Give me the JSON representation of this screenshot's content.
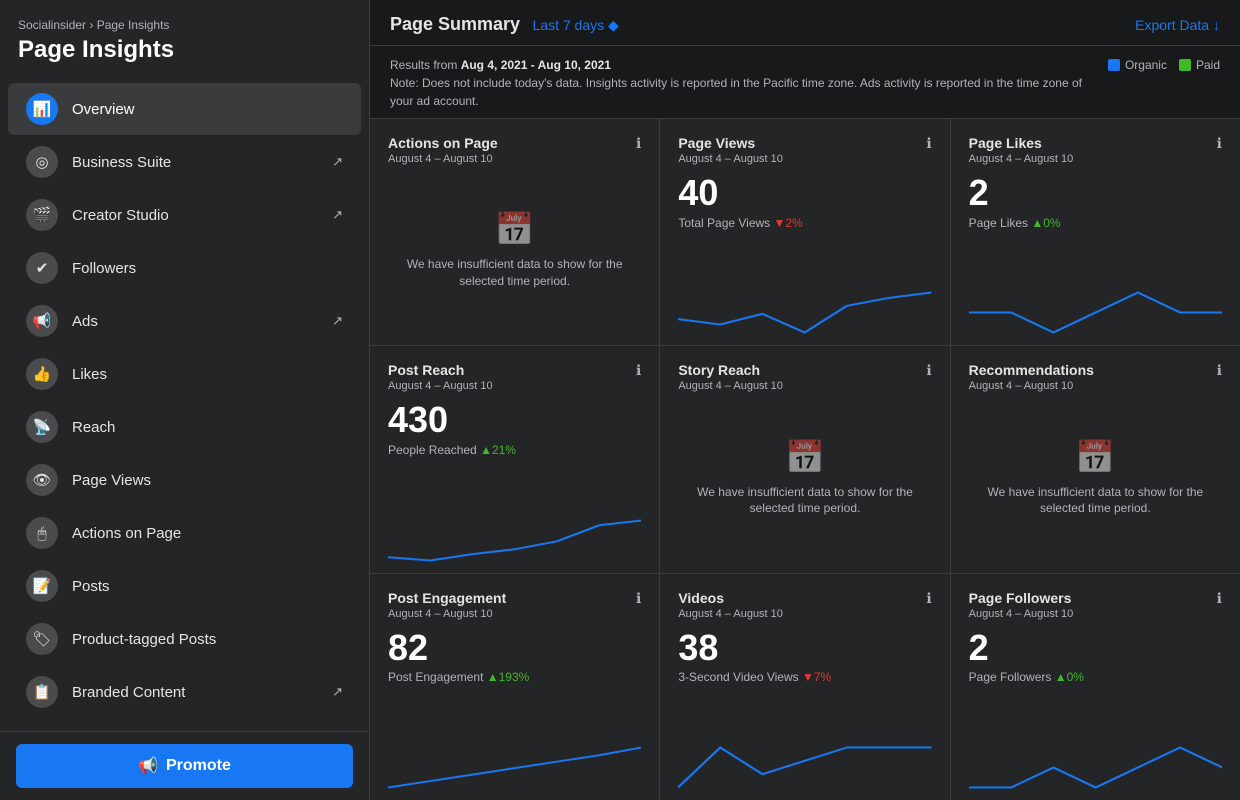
{
  "sidebar": {
    "breadcrumb": "Socialinsider › Page Insights",
    "title": "Page Insights",
    "nav_items": [
      {
        "id": "overview",
        "label": "Overview",
        "icon": "📊",
        "active": true,
        "external": false
      },
      {
        "id": "business-suite",
        "label": "Business Suite",
        "icon": "◎",
        "active": false,
        "external": true
      },
      {
        "id": "creator-studio",
        "label": "Creator Studio",
        "icon": "🎬",
        "active": false,
        "external": true
      },
      {
        "id": "followers",
        "label": "Followers",
        "icon": "✔",
        "active": false,
        "external": false
      },
      {
        "id": "ads",
        "label": "Ads",
        "icon": "📢",
        "active": false,
        "external": true
      },
      {
        "id": "likes",
        "label": "Likes",
        "icon": "👍",
        "active": false,
        "external": false
      },
      {
        "id": "reach",
        "label": "Reach",
        "icon": "📡",
        "active": false,
        "external": false
      },
      {
        "id": "page-views",
        "label": "Page Views",
        "icon": "👁",
        "active": false,
        "external": false
      },
      {
        "id": "actions-on-page",
        "label": "Actions on Page",
        "icon": "🖱",
        "active": false,
        "external": false
      },
      {
        "id": "posts",
        "label": "Posts",
        "icon": "📝",
        "active": false,
        "external": false
      },
      {
        "id": "product-tagged",
        "label": "Product-tagged Posts",
        "icon": "🏷",
        "active": false,
        "external": false
      },
      {
        "id": "branded-content",
        "label": "Branded Content",
        "icon": "📋",
        "active": false,
        "external": true
      }
    ],
    "promote_label": "Promote"
  },
  "header": {
    "title": "Page Summary",
    "time_filter": "Last 7 days ◆",
    "export_label": "Export Data ↓"
  },
  "results": {
    "date_range": "Aug 4, 2021 - Aug 10, 2021",
    "note": "Note: Does not include today's data. Insights activity is reported in the Pacific time zone. Ads activity is reported in the time zone of your ad account.",
    "legend": [
      {
        "label": "Organic",
        "color": "#1877f2"
      },
      {
        "label": "Paid",
        "color": "#42b72a"
      }
    ]
  },
  "metrics": [
    {
      "title": "Actions on Page",
      "date": "August 4 – August 10",
      "value": null,
      "sub_label": null,
      "change": null,
      "change_type": null,
      "insufficient": true,
      "insufficient_text": "We have insufficient data to show for the selected time period."
    },
    {
      "title": "Page Views",
      "date": "August 4 – August 10",
      "value": "40",
      "sub_label": "Total Page Views",
      "change": "▼2%",
      "change_type": "down",
      "insufficient": false
    },
    {
      "title": "Page Likes",
      "date": "August 4 – August 10",
      "value": "2",
      "sub_label": "Page Likes",
      "change": "▲0%",
      "change_type": "up",
      "insufficient": false
    },
    {
      "title": "Post Reach",
      "date": "August 4 – August 10",
      "value": "430",
      "sub_label": "People Reached",
      "change": "▲21%",
      "change_type": "up",
      "insufficient": false
    },
    {
      "title": "Story Reach",
      "date": "August 4 – August 10",
      "value": null,
      "sub_label": null,
      "change": null,
      "change_type": null,
      "insufficient": true,
      "insufficient_text": "We have insufficient data to show for the selected time period."
    },
    {
      "title": "Recommendations",
      "date": "August 4 – August 10",
      "value": null,
      "sub_label": null,
      "change": null,
      "change_type": null,
      "insufficient": true,
      "insufficient_text": "We have insufficient data to show for the selected time period."
    },
    {
      "title": "Post Engagement",
      "date": "August 4 – August 10",
      "value": "82",
      "sub_label": "Post Engagement",
      "change": "▲193%",
      "change_type": "up",
      "insufficient": false
    },
    {
      "title": "Videos",
      "date": "August 4 – August 10",
      "value": "38",
      "sub_label": "3-Second Video Views",
      "change": "▼7%",
      "change_type": "down",
      "insufficient": false
    },
    {
      "title": "Page Followers",
      "date": "August 4 – August 10",
      "value": "2",
      "sub_label": "Page Followers",
      "change": "▲0%",
      "change_type": "up",
      "insufficient": false
    }
  ],
  "charts": {
    "page_views": [
      [
        0,
        30
      ],
      [
        1,
        28
      ],
      [
        2,
        32
      ],
      [
        3,
        25
      ],
      [
        4,
        35
      ],
      [
        5,
        38
      ],
      [
        6,
        40
      ]
    ],
    "page_likes": [
      [
        0,
        2
      ],
      [
        1,
        2
      ],
      [
        2,
        1
      ],
      [
        3,
        2
      ],
      [
        4,
        3
      ],
      [
        5,
        2
      ],
      [
        6,
        2
      ]
    ],
    "post_reach": [
      [
        0,
        200
      ],
      [
        1,
        180
      ],
      [
        2,
        220
      ],
      [
        3,
        250
      ],
      [
        4,
        300
      ],
      [
        5,
        400
      ],
      [
        6,
        430
      ]
    ],
    "post_engagement": [
      [
        0,
        20
      ],
      [
        1,
        30
      ],
      [
        2,
        40
      ],
      [
        3,
        50
      ],
      [
        4,
        60
      ],
      [
        5,
        70
      ],
      [
        6,
        82
      ]
    ],
    "videos": [
      [
        0,
        35
      ],
      [
        1,
        38
      ],
      [
        2,
        36
      ],
      [
        3,
        37
      ],
      [
        4,
        38
      ],
      [
        5,
        38
      ],
      [
        6,
        38
      ]
    ],
    "page_followers": [
      [
        0,
        1
      ],
      [
        1,
        1
      ],
      [
        2,
        2
      ],
      [
        3,
        1
      ],
      [
        4,
        2
      ],
      [
        5,
        3
      ],
      [
        6,
        2
      ]
    ]
  }
}
